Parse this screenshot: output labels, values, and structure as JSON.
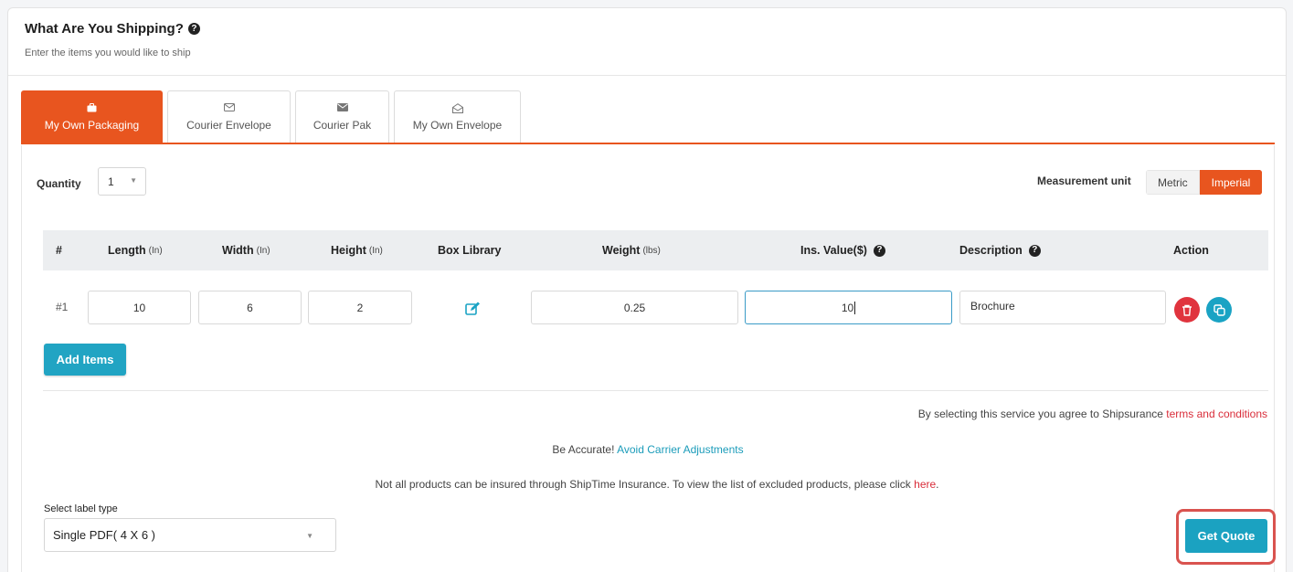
{
  "header": {
    "title": "What Are You Shipping?",
    "help_icon": "question-circle-icon",
    "subtitle": "Enter the items you would like to ship"
  },
  "tabs": [
    {
      "label": "My Own Packaging",
      "icon": "briefcase-icon",
      "active": true
    },
    {
      "label": "Courier Envelope",
      "icon": "envelope-outline-icon",
      "active": false
    },
    {
      "label": "Courier Pak",
      "icon": "envelope-filled-icon",
      "active": false
    },
    {
      "label": "My Own Envelope",
      "icon": "envelope-open-icon",
      "active": false
    }
  ],
  "quantity": {
    "label": "Quantity",
    "value": "1"
  },
  "measurement": {
    "label": "Measurement unit",
    "options": [
      "Metric",
      "Imperial"
    ],
    "selected": "Imperial"
  },
  "table": {
    "headers": {
      "num": "#",
      "length": "Length",
      "length_unit": "(In)",
      "width": "Width",
      "width_unit": "(In)",
      "height": "Height",
      "height_unit": "(In)",
      "box_library": "Box Library",
      "weight": "Weight",
      "weight_unit": "(lbs)",
      "ins_value": "Ins. Value($)",
      "description": "Description",
      "action": "Action"
    },
    "rows": [
      {
        "num": "#1",
        "length": "10",
        "width": "6",
        "height": "2",
        "weight": "0.25",
        "ins_value": "10",
        "description": "Brochure"
      }
    ]
  },
  "add_items_label": "Add Items",
  "notes": {
    "insurance_prefix": "By selecting this service you agree to Shipsurance ",
    "insurance_link": "terms and conditions",
    "accurate_prefix": "Be Accurate! ",
    "accurate_link": "Avoid Carrier Adjustments",
    "excluded_prefix": "Not all products can be insured through ShipTime Insurance. To view the list of excluded products, please click ",
    "excluded_link": "here",
    "excluded_suffix": "."
  },
  "label_type": {
    "label": "Select label type",
    "value": "Single PDF( 4 X 6 )"
  },
  "get_quote_label": "Get Quote",
  "colors": {
    "accent": "#e8551f",
    "teal": "#21a4c3",
    "danger": "#e0343e"
  }
}
